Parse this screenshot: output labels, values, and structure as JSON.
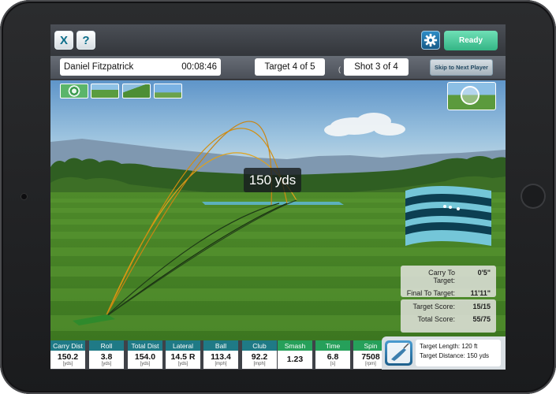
{
  "toolbar": {
    "close_label": "X",
    "help_label": "?",
    "settings_icon": "gear-icon",
    "ready_label": "Ready"
  },
  "header": {
    "player_name": "Daniel Fitzpatrick",
    "timer": "00:08:46",
    "target_progress": "Target 4 of 5",
    "shot_progress": "Shot 3 of 4",
    "skip_label": "Skip to Next Player"
  },
  "scene": {
    "camera_views": [
      "target-view-icon",
      "range-view-icon",
      "side-view-icon",
      "ball-view-icon"
    ],
    "ball_cam_icon": "magnifier-icon",
    "distance_label": "150 yds"
  },
  "scoreboard": {
    "carry_to_target_label": "Carry To Target:",
    "carry_to_target_value": "0'5\"",
    "final_to_target_label": "Final To Target:",
    "final_to_target_value": "11'11\"",
    "target_score_label": "Target Score:",
    "target_score_value": "15/15",
    "total_score_label": "Total Score:",
    "total_score_value": "55/75"
  },
  "stats": [
    {
      "label": "Carry Dist",
      "value": "150.2",
      "unit": "[yds]",
      "color": "#1f7a86"
    },
    {
      "label": "Roll",
      "value": "3.8",
      "unit": "[yds]",
      "color": "#1f7a86"
    },
    {
      "label": "Total Dist",
      "value": "154.0",
      "unit": "[yds]",
      "color": "#1f7a86"
    },
    {
      "label": "Lateral",
      "value": "14.5 R",
      "unit": "[yds]",
      "color": "#1f7a86"
    },
    {
      "label": "Ball",
      "value": "113.4",
      "unit": "[mph]",
      "color": "#1f7a86"
    },
    {
      "label": "Club",
      "value": "92.2",
      "unit": "[mph]",
      "color": "#1f7a86"
    },
    {
      "label": "Smash",
      "value": "1.23",
      "unit": "",
      "color": "#26a05a"
    },
    {
      "label": "Time",
      "value": "6.8",
      "unit": "[s]",
      "color": "#26a05a"
    },
    {
      "label": "Spin",
      "value": "7508",
      "unit": "[rpm]",
      "color": "#26a05a"
    }
  ],
  "target_info": {
    "club_icon": "golf-club-icon",
    "length": "Target Length: 120 ft",
    "distance": "Target Distance: 150 yds"
  }
}
